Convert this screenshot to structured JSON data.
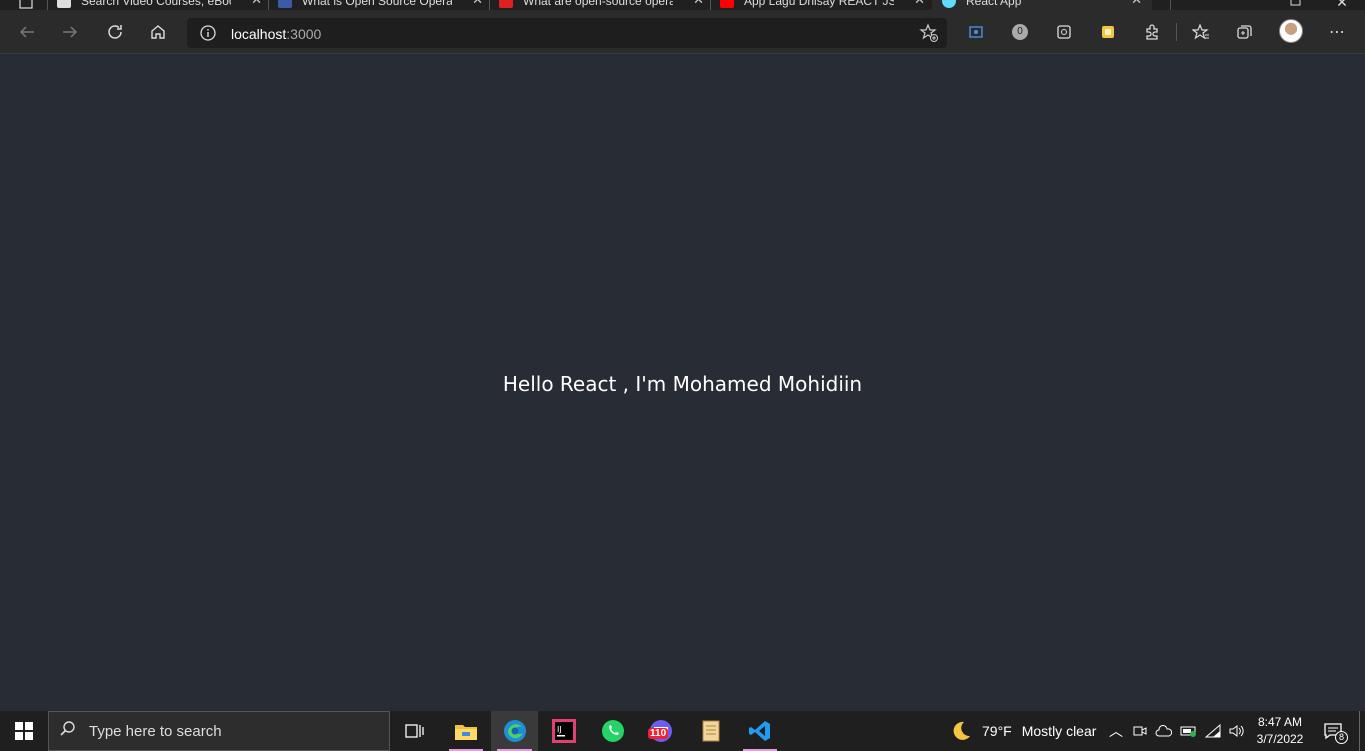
{
  "browser": {
    "tabs": [
      {
        "title": "Search Video Courses, eBooks",
        "color": "#dddddd"
      },
      {
        "title": "What is Open Source Operati",
        "color": "#3b5ba5"
      },
      {
        "title": "What are open-source opera",
        "color": "#e02020"
      },
      {
        "title": "App Lagu Dhisay REACT JS",
        "color": "#ff0000"
      },
      {
        "title": "React App",
        "color": "#61dafb"
      }
    ],
    "url_host": "localhost",
    "url_port": ":3000",
    "extension_badge": "0"
  },
  "page": {
    "heading": "Hello React , I'm Mohamed Mohidiin"
  },
  "taskbar": {
    "search_placeholder": "Type here to search",
    "calendar_badge": "110",
    "weather_temp": "79°F",
    "weather_desc": "Mostly clear",
    "time": "8:47 AM",
    "date": "3/7/2022",
    "notification_count": "8"
  },
  "colors": {
    "page_bg": "#282c34",
    "chrome_bg": "#2b2b2b",
    "taskbar_bg": "#1f1f1f",
    "accent_underline": "#e79be0"
  }
}
